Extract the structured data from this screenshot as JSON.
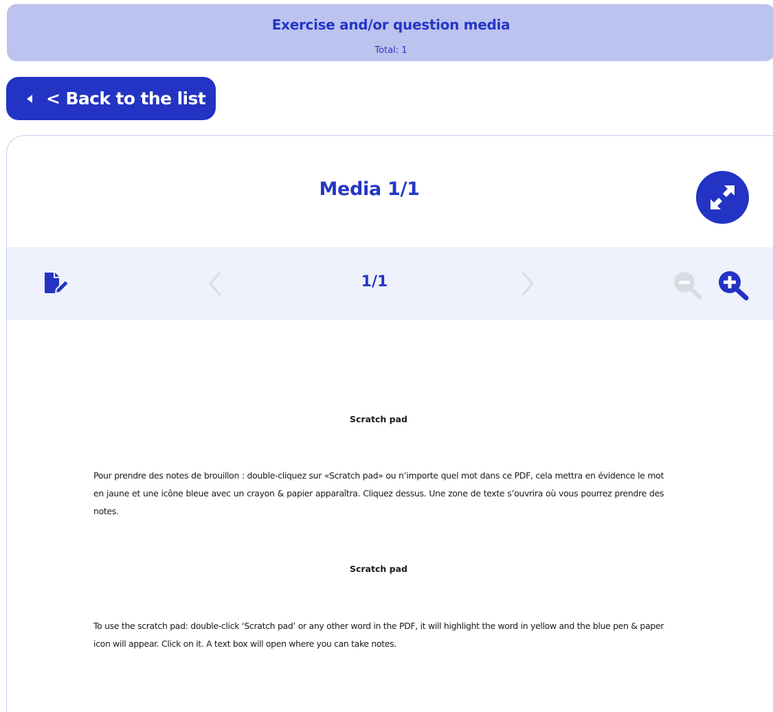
{
  "header": {
    "title": "Exercise and/or question media",
    "total": "Total: 1"
  },
  "back_button": {
    "label": "< Back to the list"
  },
  "media": {
    "title": "Media 1/1",
    "expand_icon": "expand-arrows-icon"
  },
  "toolbar": {
    "scratch_icon": "scratch-pad-icon",
    "prev_icon": "chevron-left-icon",
    "page_indicator": "1/1",
    "next_icon": "chevron-right-icon",
    "zoom_out_icon": "zoom-out-icon",
    "zoom_in_icon": "zoom-in-icon"
  },
  "pdf": {
    "heading_fr": "Scratch pad",
    "paragraph_fr": "Pour prendre des notes de brouillon : double-cliquez sur «Scratch pad» ou n’importe quel mot dans ce PDF, cela mettra en évidence le mot en jaune et une icône bleue avec un crayon & papier apparaîtra. Cliquez dessus. Une zone de texte s’ouvrira où vous pourrez prendre des notes.",
    "heading_en": "Scratch pad",
    "paragraph_en": "To use the scratch pad: double-click ‘Scratch pad’ or any other word in the PDF, it will highlight the word in yellow and the blue pen & paper icon will appear. Click on it. A text box will open where you can take notes."
  },
  "colors": {
    "brand_blue": "#2333c3",
    "banner_bg": "#bcc3ee",
    "toolbar_bg": "#eff2fc",
    "disabled": "#d9dce3"
  }
}
